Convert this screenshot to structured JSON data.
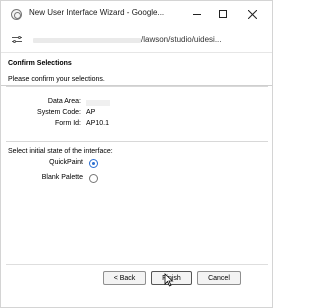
{
  "window": {
    "title": "New User Interface Wizard - Google...",
    "minimize_icon": "minimize-icon",
    "maximize_icon": "maximize-icon",
    "close_icon": "close-icon"
  },
  "address_bar": {
    "site_icon": "tune-icon",
    "url_visible": "/lawson/studio/uidesi..."
  },
  "dialog": {
    "title": "Confirm Selections",
    "subtitle": "Please confirm your selections.",
    "fields": [
      {
        "label": "Data Area:",
        "value": ""
      },
      {
        "label": "System Code:",
        "value": "AP"
      },
      {
        "label": "Form Id:",
        "value": "AP10.1"
      }
    ],
    "state_label": "Select initial state of the interface:",
    "options": [
      {
        "label": "QuickPaint",
        "selected": true
      },
      {
        "label": "Blank Palette",
        "selected": false
      }
    ]
  },
  "buttons": {
    "back": "< Back",
    "finish": "Finish",
    "cancel": "Cancel"
  },
  "colors": {
    "radio_selected": "#2c6fd1"
  }
}
